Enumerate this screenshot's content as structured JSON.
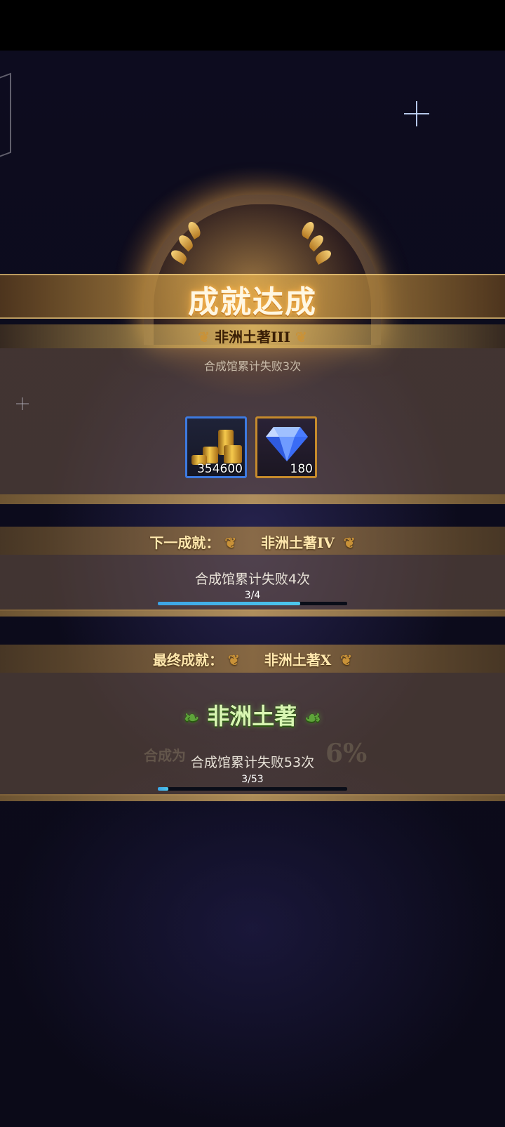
{
  "achievement": {
    "banner_title": "成就达成",
    "name": "非洲土著III",
    "description": "合成馆累计失败3次",
    "rewards": [
      {
        "type": "gold-coins",
        "quantity": "354600"
      },
      {
        "type": "diamond",
        "quantity": "180"
      }
    ]
  },
  "next_achievement": {
    "label": "下一成就：",
    "name": "非洲土著IV",
    "task": "合成馆累计失败4次",
    "progress_text": "3/4",
    "progress_fraction": 0.75
  },
  "final_achievement": {
    "label": "最终成就：",
    "name": "非洲土著X",
    "badge_text": "非洲土著",
    "task": "合成馆累计失败53次",
    "progress_text": "3/53",
    "progress_fraction": 0.057
  },
  "background_faded_text": {
    "left": "合成为",
    "percent": "6%"
  },
  "colors": {
    "gold_accent": "#ffe7ad",
    "progress_fill": "#4cc7ec",
    "gold_frame": "#c58a2c",
    "blue_frame": "#3d7ae0"
  }
}
